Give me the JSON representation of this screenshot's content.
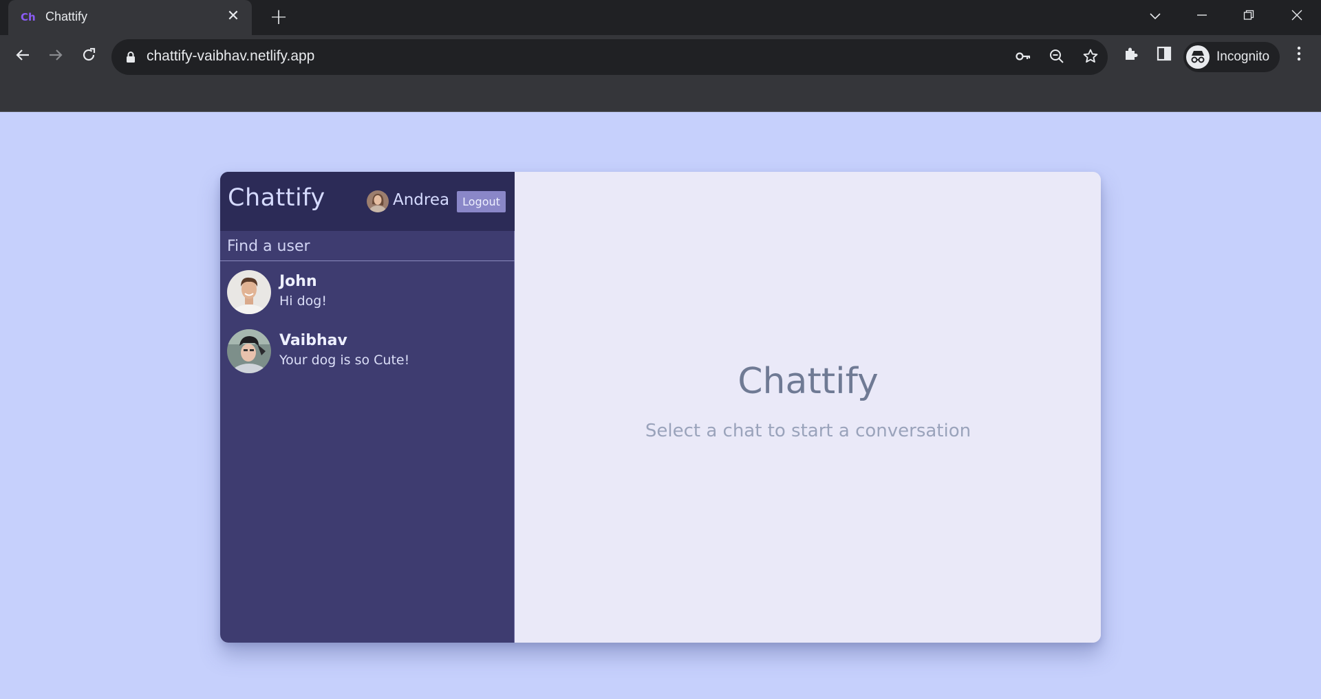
{
  "browser": {
    "tab_favicon": "Ch",
    "tab_title": "Chattify",
    "tab_close": "✕",
    "new_tab": "+",
    "url": "chattify-vaibhav.netlify.app",
    "profile_label": "Incognito",
    "icons": [
      "back-icon",
      "forward-icon",
      "reload-icon",
      "lock-icon",
      "key-icon",
      "zoom-out-icon",
      "star-icon",
      "extensions-icon",
      "side-panel-icon",
      "incognito-icon",
      "menu-icon"
    ]
  },
  "sidebar": {
    "logo": "Chattify",
    "current_user": "Andrea",
    "logout_label": "Logout",
    "search_placeholder": "Find a user",
    "chats": [
      {
        "name": "John",
        "last_message": "Hi dog!"
      },
      {
        "name": "Vaibhav",
        "last_message": "Your dog is so Cute!"
      }
    ]
  },
  "main": {
    "title": "Chattify",
    "subtitle": "Select a chat to start a conversation"
  },
  "colors": {
    "page_bg": "#c6d0fc",
    "sidebar_bg": "#3e3c70",
    "sidebar_header_bg": "#2c2b57",
    "logout_bg": "#8a87c8",
    "main_bg": "#eae9f8"
  }
}
